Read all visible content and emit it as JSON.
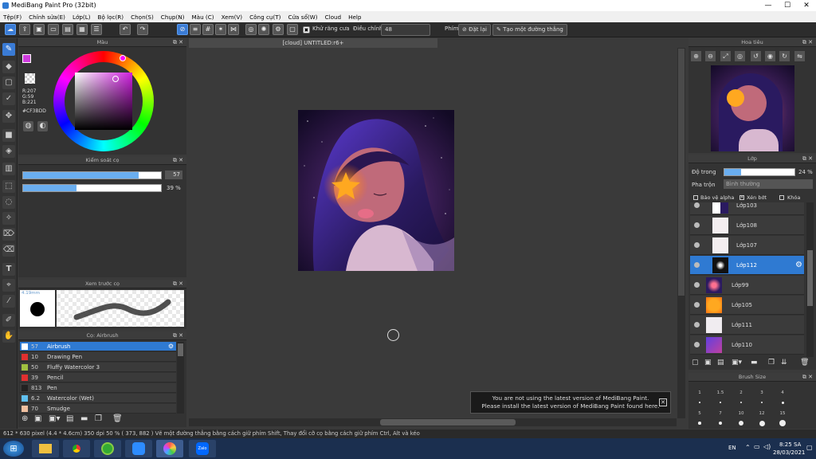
{
  "window": {
    "title": "MediBang Paint Pro (32bit)",
    "minimize": "—",
    "maximize": "☐",
    "close": "✕"
  },
  "menu": [
    "Tệp(F)",
    "Chỉnh sửa(E)",
    "Lớp(L)",
    "Bộ lọc(R)",
    "Chọn(S)",
    "Chụp(N)",
    "Màu (C)",
    "Xem(V)",
    "Công cụ(T)",
    "Cửa sổ(W)",
    "Cloud",
    "Help"
  ],
  "toolbar": {
    "antialias_label": "Khử răng cưa",
    "adjust_label": "Điều chỉnh",
    "adjust_value": "48",
    "pen_label": "Phím",
    "reset_label": "Đặt lại",
    "straight_line_label": "Tạo một đường thẳng"
  },
  "color_panel": {
    "title": "Màu",
    "r": "R:207",
    "g": "G:59",
    "b": "B:221",
    "hex": "#CF3BDD",
    "primary_color": "#cf3bdd"
  },
  "brush_control": {
    "title": "Kiểm soát cọ",
    "size_value": "57",
    "size_fill": 0.84,
    "opacity_value": "39 %",
    "opacity_fill": 0.39
  },
  "brush_preview": {
    "title": "Xem trước cọ",
    "size_label": "4.19mm"
  },
  "brush_list": {
    "title": "Cọ: Airbrush",
    "items": [
      {
        "size": "57",
        "name": "Airbrush",
        "color": "#ffffff"
      },
      {
        "size": "10",
        "name": "Drawing Pen",
        "color": "#e03030"
      },
      {
        "size": "50",
        "name": "Fluffy Watercolor 3",
        "color": "#a0c040"
      },
      {
        "size": "39",
        "name": "Pencil",
        "color": "#e03030"
      },
      {
        "size": "813",
        "name": "Pen",
        "color": "#222222"
      },
      {
        "size": "6.2",
        "name": "Watercolor (Wet)",
        "color": "#60c0f0"
      },
      {
        "size": "70",
        "name": "Smudge",
        "color": "#f0c0a0"
      }
    ]
  },
  "canvas": {
    "tab": "[cloud] UNTITLED:r6+"
  },
  "notification": {
    "line1": "You are not using the latest version of MediBang Paint.",
    "line2": "Please install the latest version of MediBang Paint found here."
  },
  "navigator": {
    "title": "Hoa tiêu"
  },
  "layer_panel": {
    "title": "Lớp",
    "opacity_label": "Độ trong",
    "opacity_value": "24 %",
    "opacity_fill": 0.24,
    "blend_label": "Pha trộn",
    "blend_value": "Bình thường",
    "protect_alpha": "Bảo vệ alpha",
    "clipping": "Xén bớt",
    "lock": "Khóa",
    "layers": [
      {
        "name": "Lớp103",
        "selected": false
      },
      {
        "name": "Lớp108",
        "selected": false
      },
      {
        "name": "Lớp107",
        "selected": false
      },
      {
        "name": "Lớp112",
        "selected": true
      },
      {
        "name": "Lớp99",
        "selected": false
      },
      {
        "name": "Lớp105",
        "selected": false
      },
      {
        "name": "Lớp111",
        "selected": false
      },
      {
        "name": "Lớp110",
        "selected": false
      }
    ]
  },
  "brush_size_panel": {
    "title": "Brush Size",
    "sizes": [
      "1",
      "1.5",
      "2",
      "3",
      "4",
      "5",
      "7",
      "10",
      "12",
      "15"
    ]
  },
  "statusbar": {
    "dims": "612 * 630 pixel",
    "dims_cm": "(4.4 * 4.6cm)",
    "dpi": "350 dpi",
    "zoom": "50 %",
    "coords": "( 373, 882 )",
    "hint": "Vẽ một đường thẳng bằng cách giữ phím Shift, Thay đổi cỡ cọ bằng cách giữ phím Ctrl, Alt và kéo"
  },
  "taskbar": {
    "lang": "EN",
    "time": "8:25 SA",
    "date": "28/03/2021"
  }
}
